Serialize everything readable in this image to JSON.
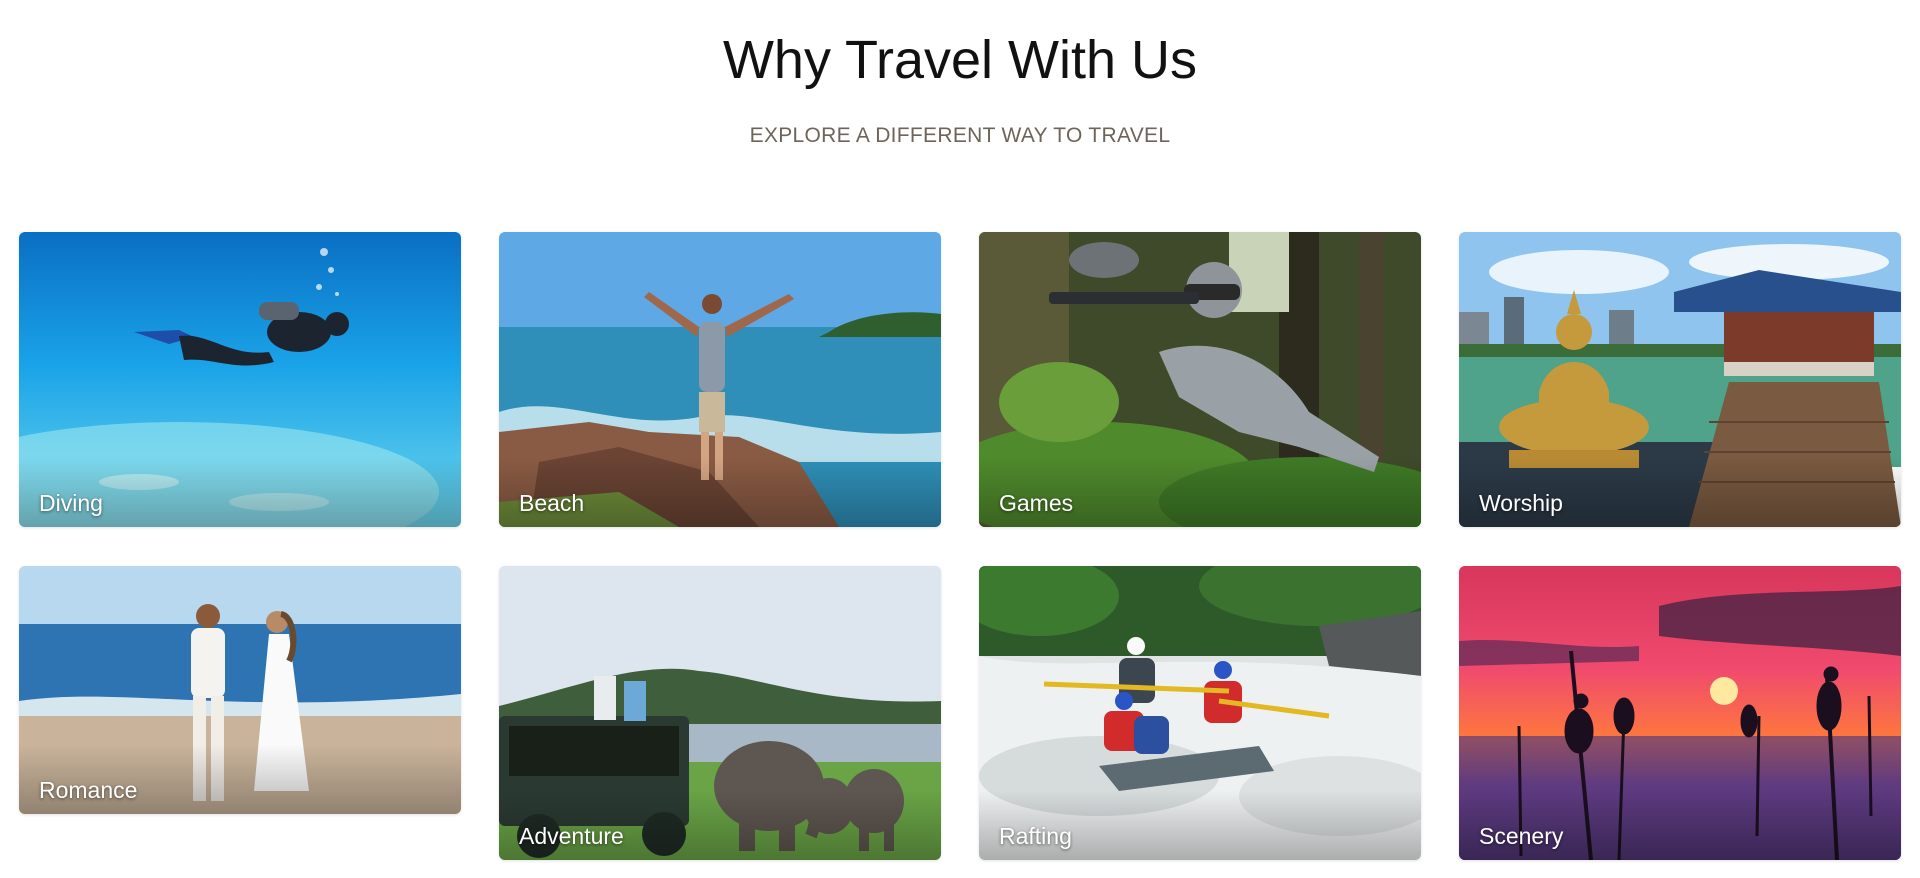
{
  "section": {
    "title": "Why Travel With Us",
    "subtitle": "EXPLORE A DIFFERENT WAY TO TRAVEL"
  },
  "cards": [
    {
      "label": "Diving",
      "image": "scuba-diver-underwater-image"
    },
    {
      "label": "Beach",
      "image": "man-on-coastal-rocks-image"
    },
    {
      "label": "Games",
      "image": "paintball-player-in-forest-image"
    },
    {
      "label": "Worship",
      "image": "buddha-statue-temple-lake-image"
    },
    {
      "label": "Romance",
      "image": "couple-walking-on-beach-image"
    },
    {
      "label": "Adventure",
      "image": "safari-jeep-elephants-image"
    },
    {
      "label": "Rafting",
      "image": "whitewater-rafting-image"
    },
    {
      "label": "Scenery",
      "image": "stilt-fishermen-sunset-image"
    }
  ]
}
